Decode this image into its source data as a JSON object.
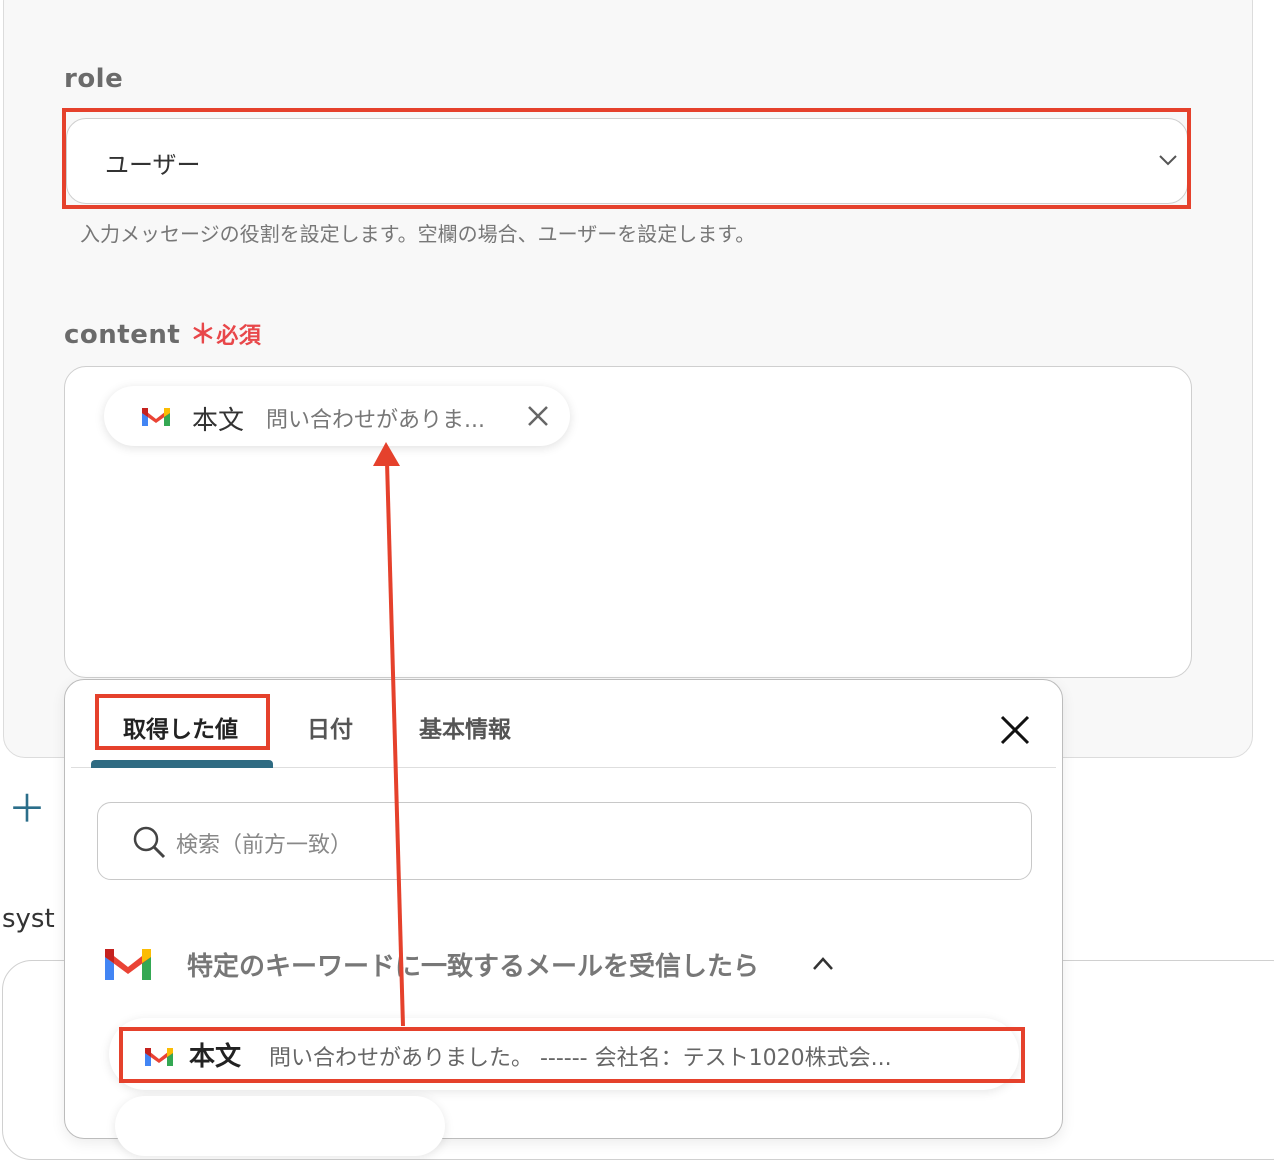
{
  "role": {
    "label": "role",
    "value": "ユーザー",
    "hint": "入力メッセージの役割を設定します。空欄の場合、ユーザーを設定します。"
  },
  "content": {
    "label": "content",
    "required_mark": "＊",
    "required_text": "必須",
    "pill": {
      "icon": "gmail-icon",
      "title": "本文",
      "text": "問い合わせがありま..."
    }
  },
  "add": {
    "icon": "plus-icon"
  },
  "system_label": "syst",
  "popup": {
    "tabs": [
      {
        "label": "取得した値"
      },
      {
        "label": "日付"
      },
      {
        "label": "基本情報"
      }
    ],
    "search_placeholder": "検索（前方一致）",
    "group": {
      "icon": "gmail-icon",
      "title": "特定のキーワードに一致するメールを受信したら"
    },
    "items": [
      {
        "icon": "gmail-icon",
        "title": "本文",
        "text": "問い合わせがありました。 ------ 会社名：テスト1020株式会..."
      }
    ]
  },
  "colors": {
    "highlight": "#e5412c",
    "accent": "#2f6b82",
    "required": "#e8474a"
  }
}
